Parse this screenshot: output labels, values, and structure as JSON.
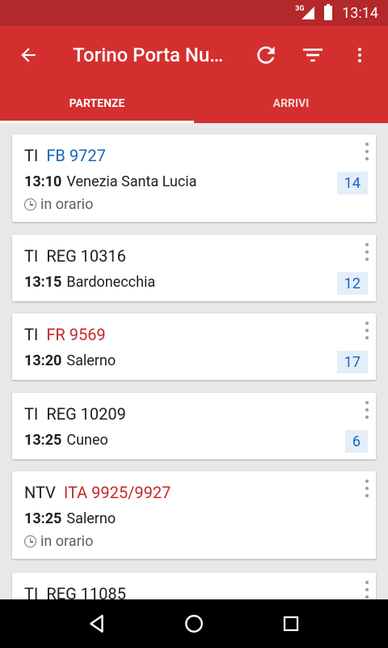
{
  "status": {
    "network": "3G",
    "time": "13:14"
  },
  "appbar": {
    "title": "Torino Porta Nu…"
  },
  "tabs": [
    {
      "label": "PARTENZE",
      "active": true
    },
    {
      "label": "ARRIVI",
      "active": false
    }
  ],
  "colors": {
    "primary": "#d42f2f",
    "status_bar": "#b3282a",
    "link_blue": "#1565c0",
    "link_red": "#c62828",
    "track_bg": "#e3eef9"
  },
  "trains": [
    {
      "company": "TI",
      "code": "FB 9727",
      "code_color": "#1565c0",
      "time": "13:10",
      "destination": "Venezia Santa Lucia",
      "track": "14",
      "status": "in orario"
    },
    {
      "company": "TI",
      "code": "REG 10316",
      "code_color": "#212121",
      "time": "13:15",
      "destination": "Bardonecchia",
      "track": "12",
      "status": ""
    },
    {
      "company": "TI",
      "code": "FR 9569",
      "code_color": "#c62828",
      "time": "13:20",
      "destination": "Salerno",
      "track": "17",
      "status": ""
    },
    {
      "company": "TI",
      "code": "REG 10209",
      "code_color": "#212121",
      "time": "13:25",
      "destination": "Cuneo",
      "track": "6",
      "status": ""
    },
    {
      "company": "NTV",
      "code": "ITA 9925/9927",
      "code_color": "#c62828",
      "time": "13:25",
      "destination": "Salerno",
      "track": "",
      "status": "in orario"
    },
    {
      "company": "TI",
      "code": "REG 11085",
      "code_color": "#212121",
      "time": "",
      "destination": "",
      "track": "",
      "status": ""
    }
  ]
}
